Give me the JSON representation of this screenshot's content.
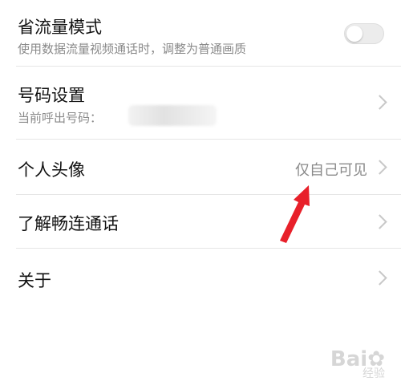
{
  "colors": {
    "text_primary": "#111111",
    "text_secondary": "#8a8a8a",
    "divider": "#e6e6e6",
    "arrow_annotation": "#e8202a",
    "toggle_off": "#ececec"
  },
  "settings": {
    "data_saver": {
      "title": "省流量模式",
      "subtitle": "使用数据流量视频通话时，调整为普通画质",
      "toggle_state": "off",
      "toggle_icon": "toggle-switch"
    },
    "number_settings": {
      "title": "号码设置",
      "subtitle": "当前呼出号码：",
      "chevron_icon": "chevron-right"
    },
    "avatar": {
      "title": "个人头像",
      "value": "仅自己可见",
      "chevron_icon": "chevron-right"
    },
    "learn_more": {
      "title": "了解畅连通话",
      "chevron_icon": "chevron-right"
    },
    "about": {
      "title": "关于",
      "chevron_icon": "chevron-right"
    }
  },
  "annotation": {
    "icon": "red-arrow-pointing-up-right"
  },
  "watermark": {
    "text": "Bai",
    "suffix": "经验"
  }
}
